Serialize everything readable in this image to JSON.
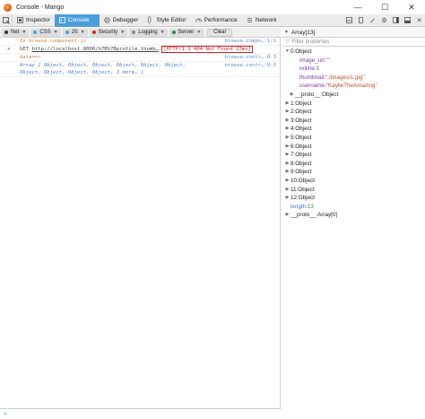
{
  "window": {
    "title": "Console - Mango",
    "controls": [
      "—",
      "☐",
      "✕"
    ]
  },
  "toolbar": {
    "tabs": [
      {
        "label": "Inspector",
        "icon": "inspector-icon",
        "active": false
      },
      {
        "label": "Console",
        "icon": "console-icon",
        "active": true
      },
      {
        "label": "Debugger",
        "icon": "debugger-icon",
        "active": false
      },
      {
        "label": "Style Editor",
        "icon": "style-editor-icon",
        "active": false
      },
      {
        "label": "Performance",
        "icon": "performance-icon",
        "active": false
      },
      {
        "label": "Network",
        "icon": "network-icon",
        "active": false
      }
    ]
  },
  "filters": {
    "tabs": [
      {
        "label": "Net",
        "color": "#333333"
      },
      {
        "label": "CSS",
        "color": "#4c9ed9"
      },
      {
        "label": "JS",
        "color": "#4c9ed9"
      },
      {
        "label": "Security",
        "color": "#d92020"
      },
      {
        "label": "Logging",
        "color": "#888888"
      },
      {
        "label": "Server",
        "color": "#2f8a3a"
      }
    ],
    "clear_label": "Clear"
  },
  "console": {
    "rows": [
      {
        "kind": "info",
        "marker": "",
        "text": "In browse.component.js",
        "location": "browse.compo…:1:1"
      },
      {
        "kind": "net",
        "marker": "✕",
        "method": "GET",
        "url": "http://localhost:8000/%7B%7Bprofile.thumb…",
        "status": "[HTTP/1.1 404 Not Found 23ms]",
        "location": ""
      },
      {
        "kind": "info",
        "marker": "",
        "text": "data==>",
        "location": "browse.contr…:8:3"
      },
      {
        "kind": "log",
        "marker": "",
        "text": "Array [ Object, Object, Object, Object, Object, Object,",
        "location": "browse.contr…:9:3"
      },
      {
        "kind": "log",
        "marker": "",
        "text": "Object, Object, Object, Object, 3 more… ]",
        "location": ""
      }
    ],
    "prompt": "»"
  },
  "sidepanel": {
    "header": "Array[13]",
    "filter_placeholder": "Filter properties",
    "tree": [
      {
        "twisty": "▼",
        "indent": 0,
        "key": "0",
        "value": "Object",
        "vclass": "plain",
        "kclass": ""
      },
      {
        "twisty": "",
        "indent": 2,
        "key": "image_url",
        "value": "\"\"",
        "vclass": "str",
        "kclass": "purple"
      },
      {
        "twisty": "",
        "indent": 2,
        "key": "online",
        "value": "1",
        "vclass": "num",
        "kclass": "purple"
      },
      {
        "twisty": "",
        "indent": 2,
        "key": "thumbnail",
        "value": "\"./images/1.jpg\"",
        "vclass": "str",
        "kclass": "purple"
      },
      {
        "twisty": "",
        "indent": 2,
        "key": "username",
        "value": "\"KaylieTheAmazing\"",
        "vclass": "str",
        "kclass": "purple"
      },
      {
        "twisty": "▶",
        "indent": 1,
        "key": "__proto__",
        "value": "Object",
        "vclass": "plain",
        "kclass": ""
      },
      {
        "twisty": "▶",
        "indent": 0,
        "key": "1",
        "value": "Object",
        "vclass": "plain",
        "kclass": ""
      },
      {
        "twisty": "▶",
        "indent": 0,
        "key": "2",
        "value": "Object",
        "vclass": "plain",
        "kclass": ""
      },
      {
        "twisty": "▶",
        "indent": 0,
        "key": "3",
        "value": "Object",
        "vclass": "plain",
        "kclass": ""
      },
      {
        "twisty": "▶",
        "indent": 0,
        "key": "4",
        "value": "Object",
        "vclass": "plain",
        "kclass": ""
      },
      {
        "twisty": "▶",
        "indent": 0,
        "key": "5",
        "value": "Object",
        "vclass": "plain",
        "kclass": ""
      },
      {
        "twisty": "▶",
        "indent": 0,
        "key": "6",
        "value": "Object",
        "vclass": "plain",
        "kclass": ""
      },
      {
        "twisty": "▶",
        "indent": 0,
        "key": "7",
        "value": "Object",
        "vclass": "plain",
        "kclass": ""
      },
      {
        "twisty": "▶",
        "indent": 0,
        "key": "8",
        "value": "Object",
        "vclass": "plain",
        "kclass": ""
      },
      {
        "twisty": "▶",
        "indent": 0,
        "key": "9",
        "value": "Object",
        "vclass": "plain",
        "kclass": ""
      },
      {
        "twisty": "▶",
        "indent": 0,
        "key": "10",
        "value": "Object",
        "vclass": "plain",
        "kclass": ""
      },
      {
        "twisty": "▶",
        "indent": 0,
        "key": "11",
        "value": "Object",
        "vclass": "plain",
        "kclass": ""
      },
      {
        "twisty": "▶",
        "indent": 0,
        "key": "12",
        "value": "Object",
        "vclass": "plain",
        "kclass": ""
      },
      {
        "twisty": "",
        "indent": 0,
        "key": "length",
        "value": "13",
        "vclass": "num",
        "kclass": "blue"
      },
      {
        "twisty": "▶",
        "indent": 0,
        "key": "__proto__",
        "value": "Array[0]",
        "vclass": "plain",
        "kclass": ""
      }
    ]
  }
}
